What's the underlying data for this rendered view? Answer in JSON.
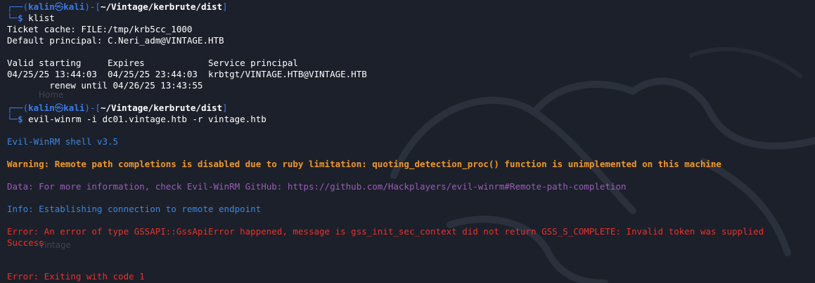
{
  "prompt": {
    "user": "kalin",
    "host": "kali",
    "cwd": "~/Vintage/kerbrute/dist"
  },
  "commands": {
    "first": "klist",
    "second": "evil-winrm -i dc01.vintage.htb -r vintage.htb"
  },
  "klist": {
    "ticket_cache": "Ticket cache: FILE:/tmp/krb5cc_1000",
    "default_principal": "Default principal: C.Neri_adm@VINTAGE.HTB",
    "header": "Valid starting     Expires            Service principal",
    "entry": "04/25/25 13:44:03  04/25/25 23:44:03  krbtgt/VINTAGE.HTB@VINTAGE.HTB",
    "renew": "        renew until 04/26/25 13:43:55"
  },
  "evilwinrm": {
    "banner": "Evil-WinRM shell v3.5",
    "warning": "Warning: Remote path completions is disabled due to ruby limitation: quoting_detection_proc() function is unimplemented on this machine",
    "data": "Data: For more information, check Evil-WinRM GitHub: https://github.com/Hackplayers/evil-winrm#Remote-path-completion",
    "info": "Info: Establishing connection to remote endpoint",
    "error1": "Error: An error of type GSSAPI::GssApiError happened, message is gss_init_sec_context did not return GSS_S_COMPLETE: Invalid token was supplied",
    "success": "Success",
    "error2": "Error: Exiting with code 1"
  },
  "background_labels": {
    "home": "Home",
    "vintage": "Vintage"
  },
  "colors": {
    "background": "#1c202a",
    "prompt_blue": "#3b7be8",
    "info_blue": "#3b86e0",
    "warning_orange": "#f0982c",
    "data_purple": "#9a5eb8",
    "error_red": "#e8312c"
  }
}
